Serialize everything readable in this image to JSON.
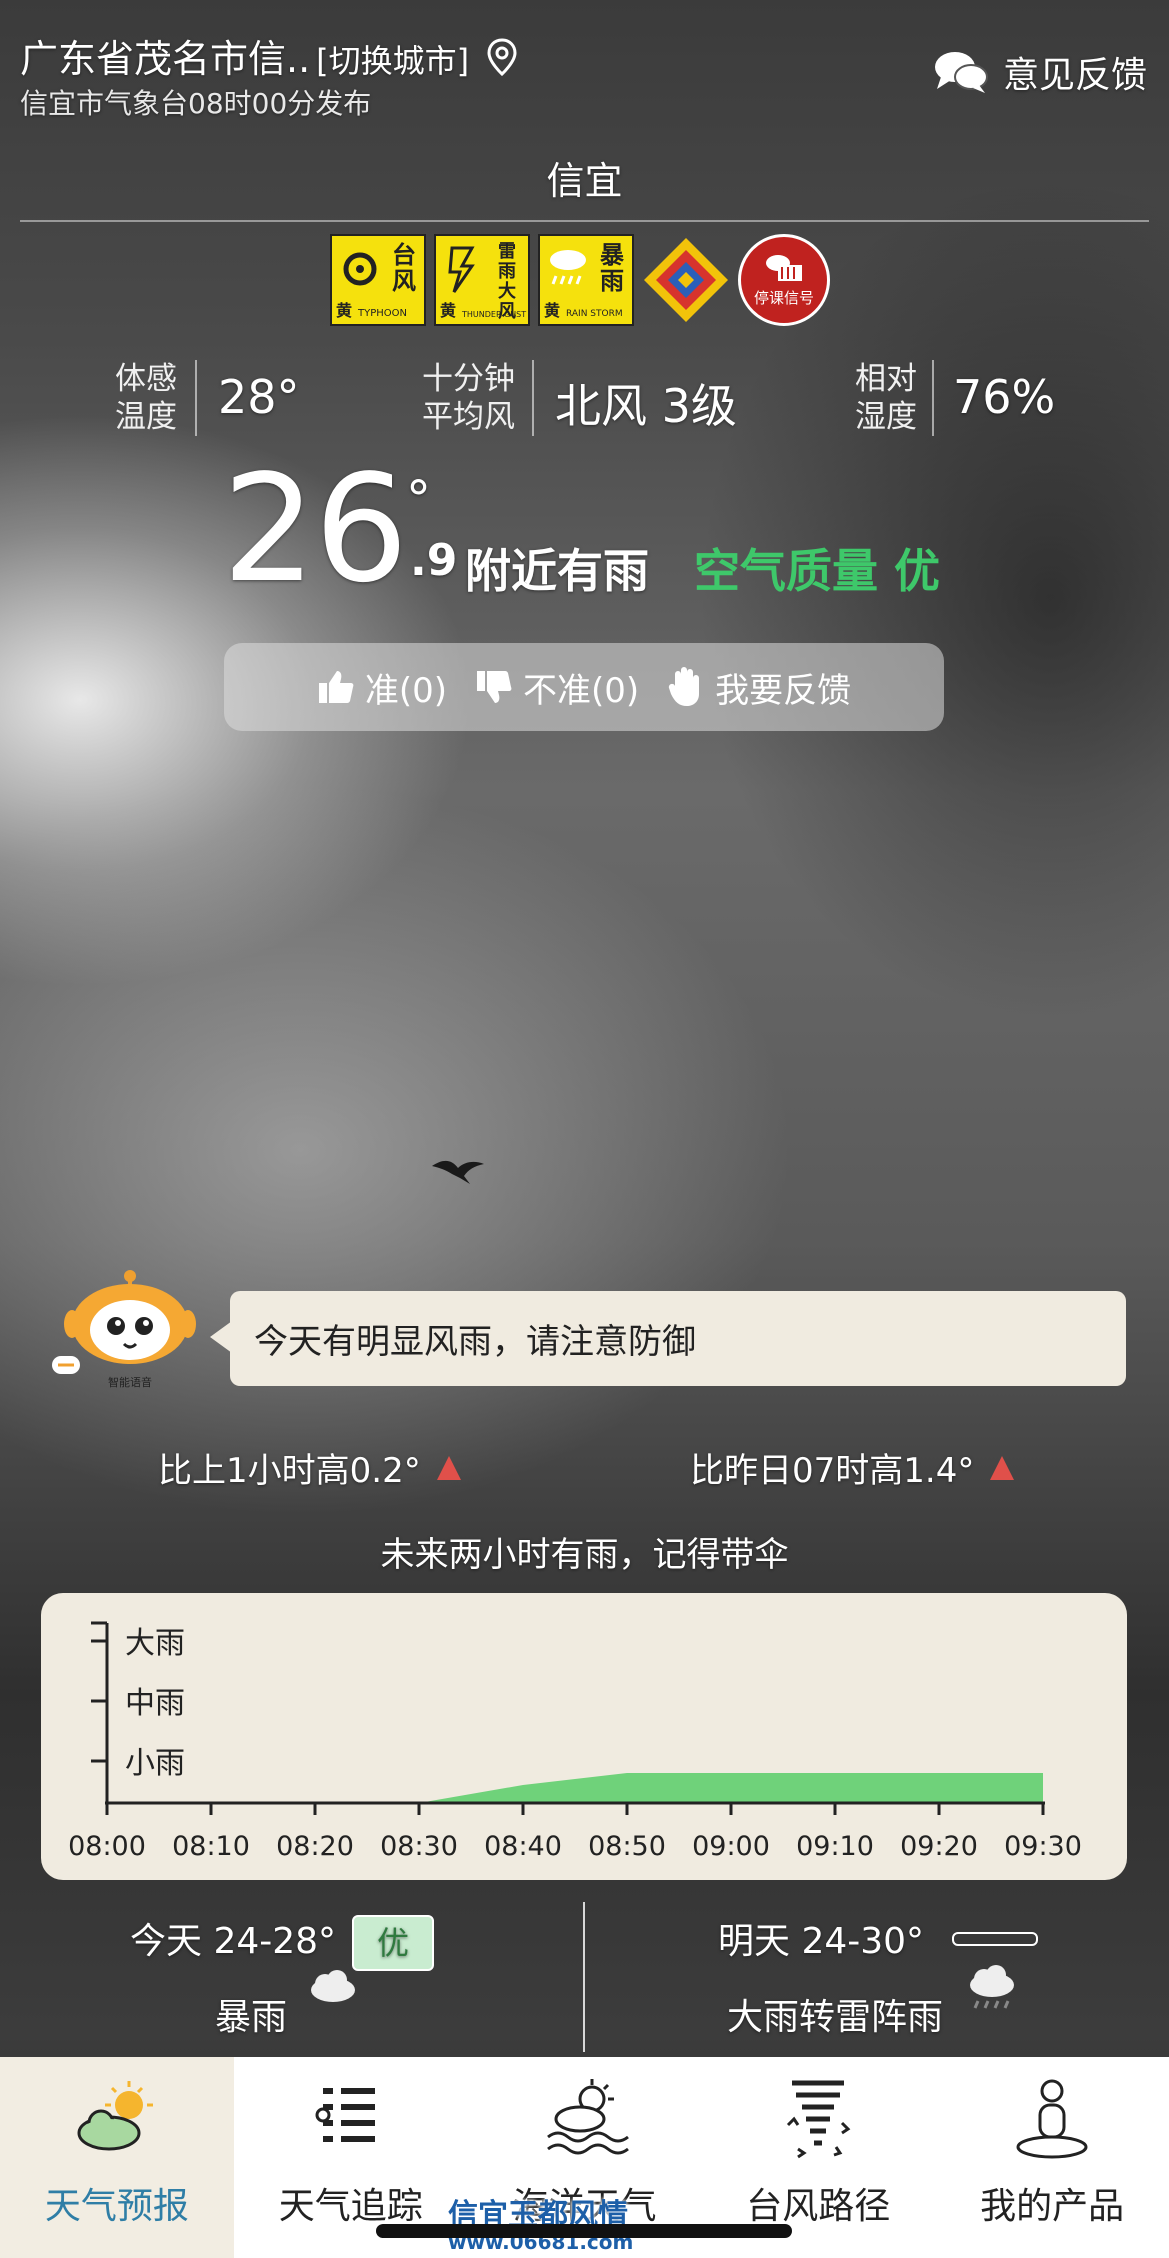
{
  "header": {
    "location": "广东省茂名市信..",
    "switch_city": "[切换城市]",
    "publish_info": "信宜市气象台08时00分发布",
    "feedback": "意见反馈",
    "city": "信宜"
  },
  "warnings": [
    {
      "cn": "台风",
      "level": "黄",
      "en": "TYPHOON",
      "icon": "typhoon-icon"
    },
    {
      "cn": "雷雨大风",
      "level": "黄",
      "en": "THUNDER GUST",
      "icon": "thunder-gust-icon"
    },
    {
      "cn": "暴雨",
      "level": "黄",
      "en": "RAIN STORM",
      "icon": "rainstorm-icon"
    },
    {
      "icon": "diamond-signal-icon"
    },
    {
      "label": "停课信号",
      "icon": "class-suspension-icon"
    }
  ],
  "stats": {
    "feel_label_1": "体感",
    "feel_label_2": "温度",
    "feel_value": "28°",
    "wind_label_1": "十分钟",
    "wind_label_2": "平均风",
    "wind_value": "北风 3级",
    "humidity_label_1": "相对",
    "humidity_label_2": "湿度",
    "humidity_value": "76%"
  },
  "current": {
    "temp": "26",
    "degree": "°",
    "decimal": ".9",
    "condition": "附近有雨",
    "aqi": "空气质量 优"
  },
  "vote": {
    "accurate": "准(0)",
    "inaccurate": "不准(0)",
    "feedback": "我要反馈"
  },
  "assistant": {
    "badge": "智能语音",
    "message": "今天有明显风雨，请注意防御"
  },
  "compare": {
    "last_hour": "比上1小时高0.2°",
    "yesterday": "比昨日07时高1.4°"
  },
  "rain_tip": "未来两小时有雨，记得带伞",
  "chart_data": {
    "type": "area",
    "x": [
      "08:00",
      "08:10",
      "08:20",
      "08:30",
      "08:40",
      "08:50",
      "09:00",
      "09:10",
      "09:20",
      "09:30"
    ],
    "y_levels": [
      "小雨",
      "中雨",
      "大雨"
    ],
    "series": [
      {
        "values": [
          0,
          0,
          0,
          0,
          0.3,
          0.5,
          0.5,
          0.5,
          0.5,
          0.5
        ]
      }
    ],
    "ylim": [
      0,
      3
    ],
    "color": "#6fd27a"
  },
  "daily": {
    "today": "今天 24-28°",
    "today_aqi": "优",
    "today_weather": "暴雨",
    "tomorrow": "明天 24-30°",
    "tomorrow_weather": "大雨转雷阵雨"
  },
  "nav": [
    {
      "label": "天气预报",
      "active": true
    },
    {
      "label": "天气追踪"
    },
    {
      "label": "海洋天气"
    },
    {
      "label": "台风路径"
    },
    {
      "label": "我的产品"
    }
  ],
  "watermark": {
    "title": "信宜玉都风情",
    "url": "www.06681.com"
  },
  "colors": {
    "accent": "#2f7ea6",
    "aqi_good": "#3ec86a",
    "rain_fill": "#6fd27a",
    "warning_yellow": "#f5e10d"
  }
}
